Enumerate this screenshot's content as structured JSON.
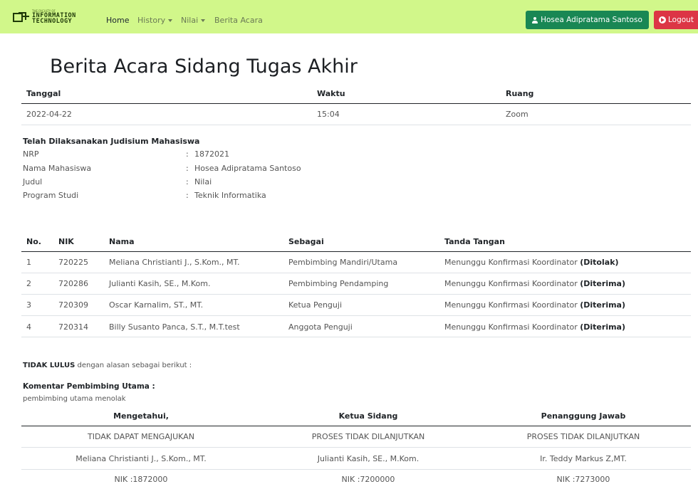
{
  "navbar": {
    "logo": {
      "small": "THE FACULTY OF",
      "line1": "INFORMATION",
      "line2": "TECHNOLOGY"
    },
    "links": [
      {
        "label": "Home",
        "active": true,
        "dropdown": false
      },
      {
        "label": "History",
        "active": false,
        "dropdown": true
      },
      {
        "label": "Nilai",
        "active": false,
        "dropdown": true
      },
      {
        "label": "Berita Acara",
        "active": false,
        "dropdown": false
      }
    ],
    "user_button": {
      "label": "Hosea Adipratama Santoso",
      "icon": "user-icon",
      "color": "#198754"
    },
    "logout_button": {
      "label": "Logout",
      "icon": "logout-icon",
      "color": "#dc3545"
    },
    "background": "#d1f78a"
  },
  "page_title": "Berita Acara Sidang Tugas Akhir",
  "meta_table": {
    "headers": [
      "Tanggal",
      "Waktu",
      "Ruang"
    ],
    "row": [
      "2022-04-22",
      "15:04",
      "Zoom"
    ]
  },
  "judisium": {
    "title": "Telah Dilaksanakan Judisium Mahasiswa",
    "fields": [
      {
        "label": "NRP",
        "value": "1872021"
      },
      {
        "label": "Nama Mahasiswa",
        "value": "Hosea Adipratama Santoso"
      },
      {
        "label": "Judul",
        "value": "Nilai"
      },
      {
        "label": "Program Studi",
        "value": "Teknik Informatika"
      }
    ],
    "separator": ":"
  },
  "examiners_table": {
    "headers": [
      "No.",
      "NIK",
      "Nama",
      "Sebagai",
      "Tanda Tangan"
    ],
    "rows": [
      {
        "no": "1",
        "nik": "720225",
        "nama": "Meliana Christianti J., S.Kom., MT.",
        "sebagai": "Pembimbing Mandiri/Utama",
        "ttd": "Menunggu Konfirmasi Koordinator",
        "status": "(Ditolak)"
      },
      {
        "no": "2",
        "nik": "720286",
        "nama": "Julianti Kasih, SE., M.Kom.",
        "sebagai": "Pembimbing Pendamping",
        "ttd": "Menunggu Konfirmasi Koordinator",
        "status": "(Diterima)"
      },
      {
        "no": "3",
        "nik": "720309",
        "nama": "Oscar Karnalim, ST., MT.",
        "sebagai": "Ketua Penguji",
        "ttd": "Menunggu Konfirmasi Koordinator",
        "status": "(Diterima)"
      },
      {
        "no": "4",
        "nik": "720314",
        "nama": "Billy Susanto Panca, S.T., M.T.test",
        "sebagai": "Anggota Penguji",
        "ttd": "Menunggu Konfirmasi Koordinator",
        "status": "(Diterima)"
      }
    ]
  },
  "result": {
    "status": "TIDAK LULUS",
    "text": "dengan alasan sebagai berikut :"
  },
  "comment": {
    "title": "Komentar Pembimbing Utama :",
    "text": "pembimbing utama menolak"
  },
  "signature_table": {
    "headers": [
      "Mengetahui,",
      "Ketua Sidang",
      "Penanggung Jawab"
    ],
    "rows": [
      [
        "TIDAK DAPAT MENGAJUKAN",
        "PROSES TIDAK DILANJUTKAN",
        "PROSES TIDAK DILANJUTKAN"
      ],
      [
        "Meliana Christianti J., S.Kom., MT.",
        "Julianti Kasih, SE., M.Kom.",
        "Ir. Teddy Markus Z,MT."
      ],
      [
        "NIK :1872000",
        "NIK :7200000",
        "NIK :7273000"
      ]
    ]
  }
}
